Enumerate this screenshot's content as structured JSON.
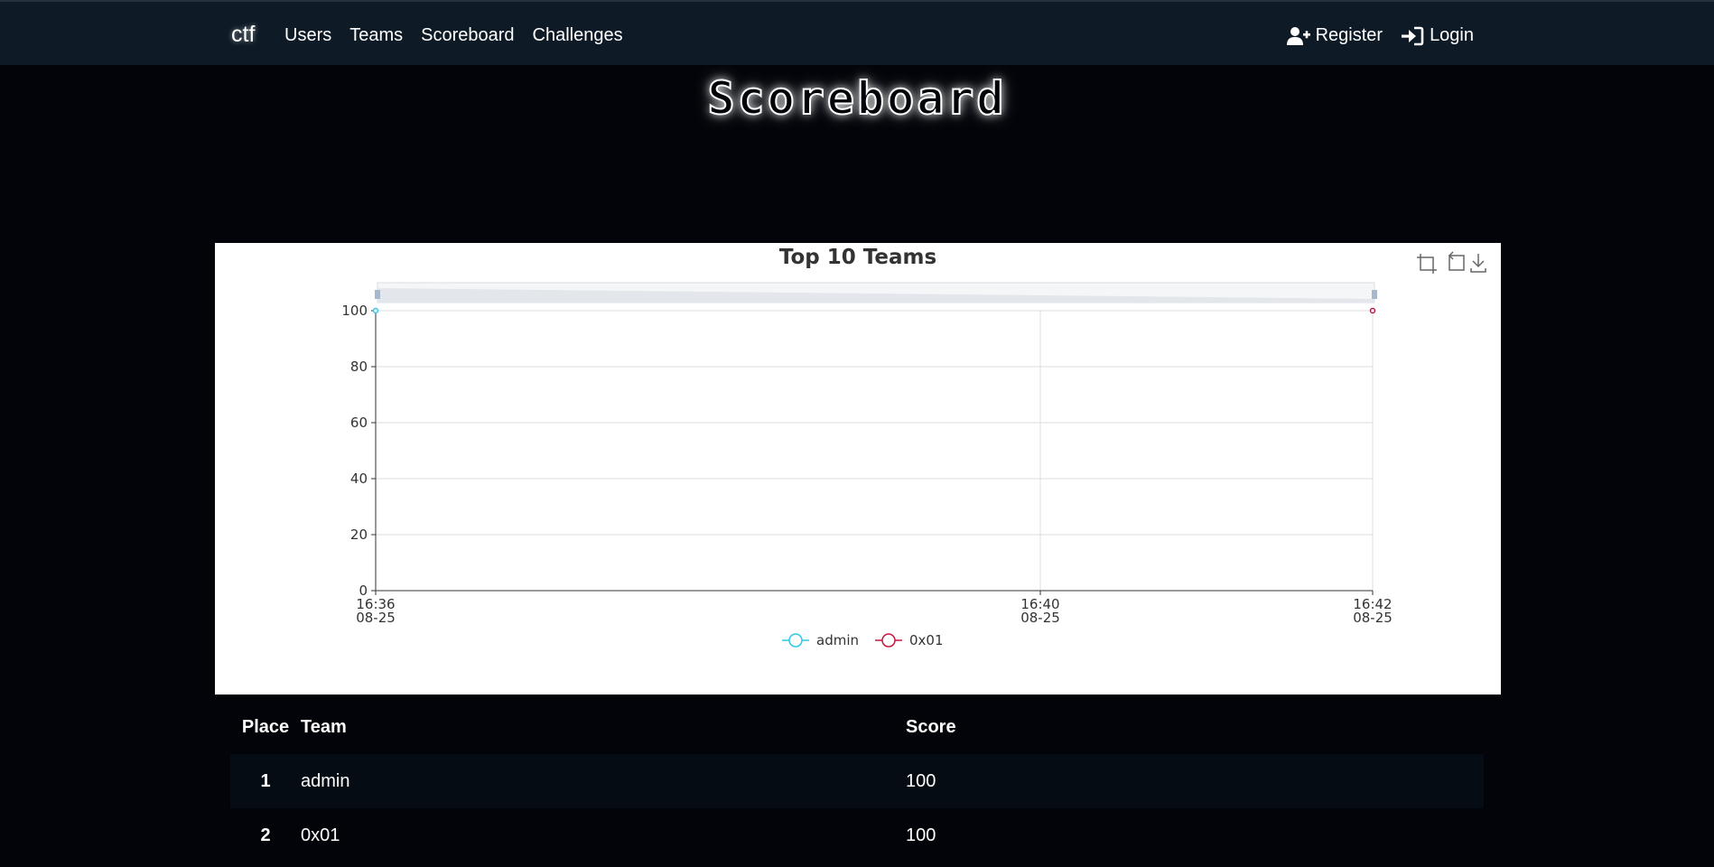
{
  "nav": {
    "brand": "ctf",
    "links": [
      "Users",
      "Teams",
      "Scoreboard",
      "Challenges"
    ],
    "register_label": "Register",
    "login_label": "Login"
  },
  "page": {
    "title": "Scoreboard"
  },
  "chart_data": {
    "type": "line",
    "title": "Top 10 Teams",
    "xlabel": "",
    "ylabel": "",
    "ylim": [
      0,
      100
    ],
    "y_ticks": [
      0,
      20,
      40,
      60,
      80,
      100
    ],
    "x_ticks": [
      {
        "time": "16:36",
        "date": "08-25"
      },
      {
        "time": "16:40",
        "date": "08-25"
      },
      {
        "time": "16:42",
        "date": "08-25"
      }
    ],
    "x_range": [
      "16:36",
      "16:42"
    ],
    "grid": true,
    "legend_position": "bottom-center",
    "series": [
      {
        "name": "admin",
        "color": "#2ec7ea",
        "points": [
          {
            "x": "16:36",
            "y": 100
          }
        ]
      },
      {
        "name": "0x01",
        "color": "#c1183f",
        "points": [
          {
            "x": "16:42",
            "y": 100
          }
        ]
      }
    ],
    "toolbox": [
      "zoom-icon",
      "reset-icon",
      "download-icon"
    ]
  },
  "table": {
    "headers": {
      "place": "Place",
      "team": "Team",
      "score": "Score"
    },
    "rows": [
      {
        "place": "1",
        "team": "admin",
        "score": "100"
      },
      {
        "place": "2",
        "team": "0x01",
        "score": "100"
      }
    ]
  }
}
